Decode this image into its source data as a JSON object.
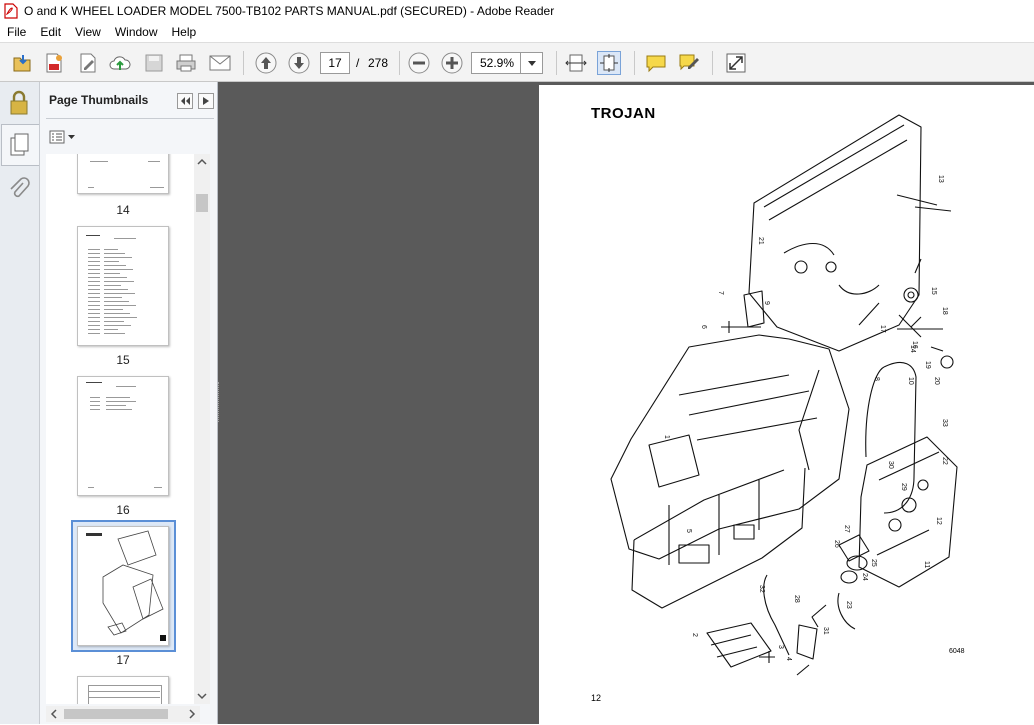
{
  "window": {
    "title": "O and K WHEEL LOADER MODEL 7500-TB102 PARTS MANUAL.pdf (SECURED) - Adobe Reader"
  },
  "menu": [
    "File",
    "Edit",
    "View",
    "Window",
    "Help"
  ],
  "toolbar": {
    "current_page": "17",
    "page_separator": "/",
    "total_pages": "278",
    "zoom": "52.9%"
  },
  "panel": {
    "title": "Page Thumbnails",
    "thumbnails": [
      {
        "label": "14",
        "selected": false
      },
      {
        "label": "15",
        "selected": false
      },
      {
        "label": "16",
        "selected": false
      },
      {
        "label": "17",
        "selected": true
      }
    ]
  },
  "document": {
    "brand": "TROJAN",
    "page_number": "12",
    "figure_code": "6048",
    "part_callouts": [
      "1",
      "2",
      "3",
      "4",
      "5",
      "6",
      "7",
      "8",
      "9",
      "10",
      "11",
      "12",
      "13",
      "14",
      "15",
      "16",
      "17",
      "18",
      "19",
      "20",
      "21",
      "22",
      "23",
      "24",
      "25",
      "26",
      "27",
      "28",
      "29",
      "30",
      "31",
      "32",
      "33"
    ]
  },
  "colors": {
    "viewer_bg": "#5a5a5a",
    "selection": "#5b8fd6",
    "toolbar_bg": "#f3f3f3"
  }
}
